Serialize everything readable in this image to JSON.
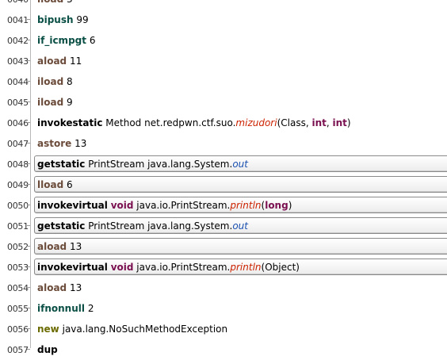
{
  "lines": [
    {
      "num": "0040",
      "op": "iload",
      "opcls": "op-brown",
      "args": [
        {
          "t": "3"
        }
      ],
      "boxed": false
    },
    {
      "num": "0041",
      "op": "bipush",
      "opcls": "op-green",
      "args": [
        {
          "t": "99"
        }
      ],
      "boxed": false
    },
    {
      "num": "0042",
      "op": "if_icmpgt",
      "opcls": "op-green",
      "args": [
        {
          "t": "6"
        }
      ],
      "boxed": false
    },
    {
      "num": "0043",
      "op": "aload",
      "opcls": "op-brown",
      "args": [
        {
          "t": "11"
        }
      ],
      "boxed": false
    },
    {
      "num": "0044",
      "op": "iload",
      "opcls": "op-brown",
      "args": [
        {
          "t": "8"
        }
      ],
      "boxed": false
    },
    {
      "num": "0045",
      "op": "iload",
      "opcls": "op-brown",
      "args": [
        {
          "t": "9"
        }
      ],
      "boxed": false
    },
    {
      "num": "0046",
      "op": "invokestatic",
      "opcls": "op-dark",
      "args": [
        {
          "t": "Method net.redpwn.ctf.suo."
        },
        {
          "t": "mizudori",
          "c": "mth"
        },
        {
          "t": "(Class, "
        },
        {
          "t": "int",
          "c": "kw"
        },
        {
          "t": ", "
        },
        {
          "t": "int",
          "c": "kw"
        },
        {
          "t": ")"
        }
      ],
      "boxed": false
    },
    {
      "num": "0047",
      "op": "astore",
      "opcls": "op-brown",
      "args": [
        {
          "t": "13"
        }
      ],
      "boxed": false
    },
    {
      "num": "0048",
      "op": "getstatic",
      "opcls": "op-dark",
      "args": [
        {
          "t": "PrintStream java.lang.System."
        },
        {
          "t": "out",
          "c": "fld"
        }
      ],
      "boxed": true
    },
    {
      "num": "0049",
      "op": "lload",
      "opcls": "op-brown",
      "args": [
        {
          "t": "6"
        }
      ],
      "boxed": true
    },
    {
      "num": "0050",
      "op": "invokevirtual",
      "opcls": "op-dark",
      "args": [
        {
          "t": "void",
          "c": "kw"
        },
        {
          "t": " java.io.PrintStream."
        },
        {
          "t": "println",
          "c": "mth"
        },
        {
          "t": "("
        },
        {
          "t": "long",
          "c": "kw"
        },
        {
          "t": ")"
        }
      ],
      "boxed": true
    },
    {
      "num": "0051",
      "op": "getstatic",
      "opcls": "op-dark",
      "args": [
        {
          "t": "PrintStream java.lang.System."
        },
        {
          "t": "out",
          "c": "fld"
        }
      ],
      "boxed": true
    },
    {
      "num": "0052",
      "op": "aload",
      "opcls": "op-brown",
      "args": [
        {
          "t": "13"
        }
      ],
      "boxed": true
    },
    {
      "num": "0053",
      "op": "invokevirtual",
      "opcls": "op-dark",
      "args": [
        {
          "t": "void",
          "c": "kw"
        },
        {
          "t": " java.io.PrintStream."
        },
        {
          "t": "println",
          "c": "mth"
        },
        {
          "t": "(Object)"
        }
      ],
      "boxed": true
    },
    {
      "num": "0054",
      "op": "aload",
      "opcls": "op-brown",
      "args": [
        {
          "t": "13"
        }
      ],
      "boxed": false
    },
    {
      "num": "0055",
      "op": "ifnonnull",
      "opcls": "op-green",
      "args": [
        {
          "t": "2"
        }
      ],
      "boxed": false
    },
    {
      "num": "0056",
      "op": "new",
      "opcls": "op-olive",
      "args": [
        {
          "t": "java.lang.NoSuchMethodException"
        }
      ],
      "boxed": false
    },
    {
      "num": "0057",
      "op": "dup",
      "opcls": "op-dark",
      "args": [],
      "boxed": false
    }
  ]
}
